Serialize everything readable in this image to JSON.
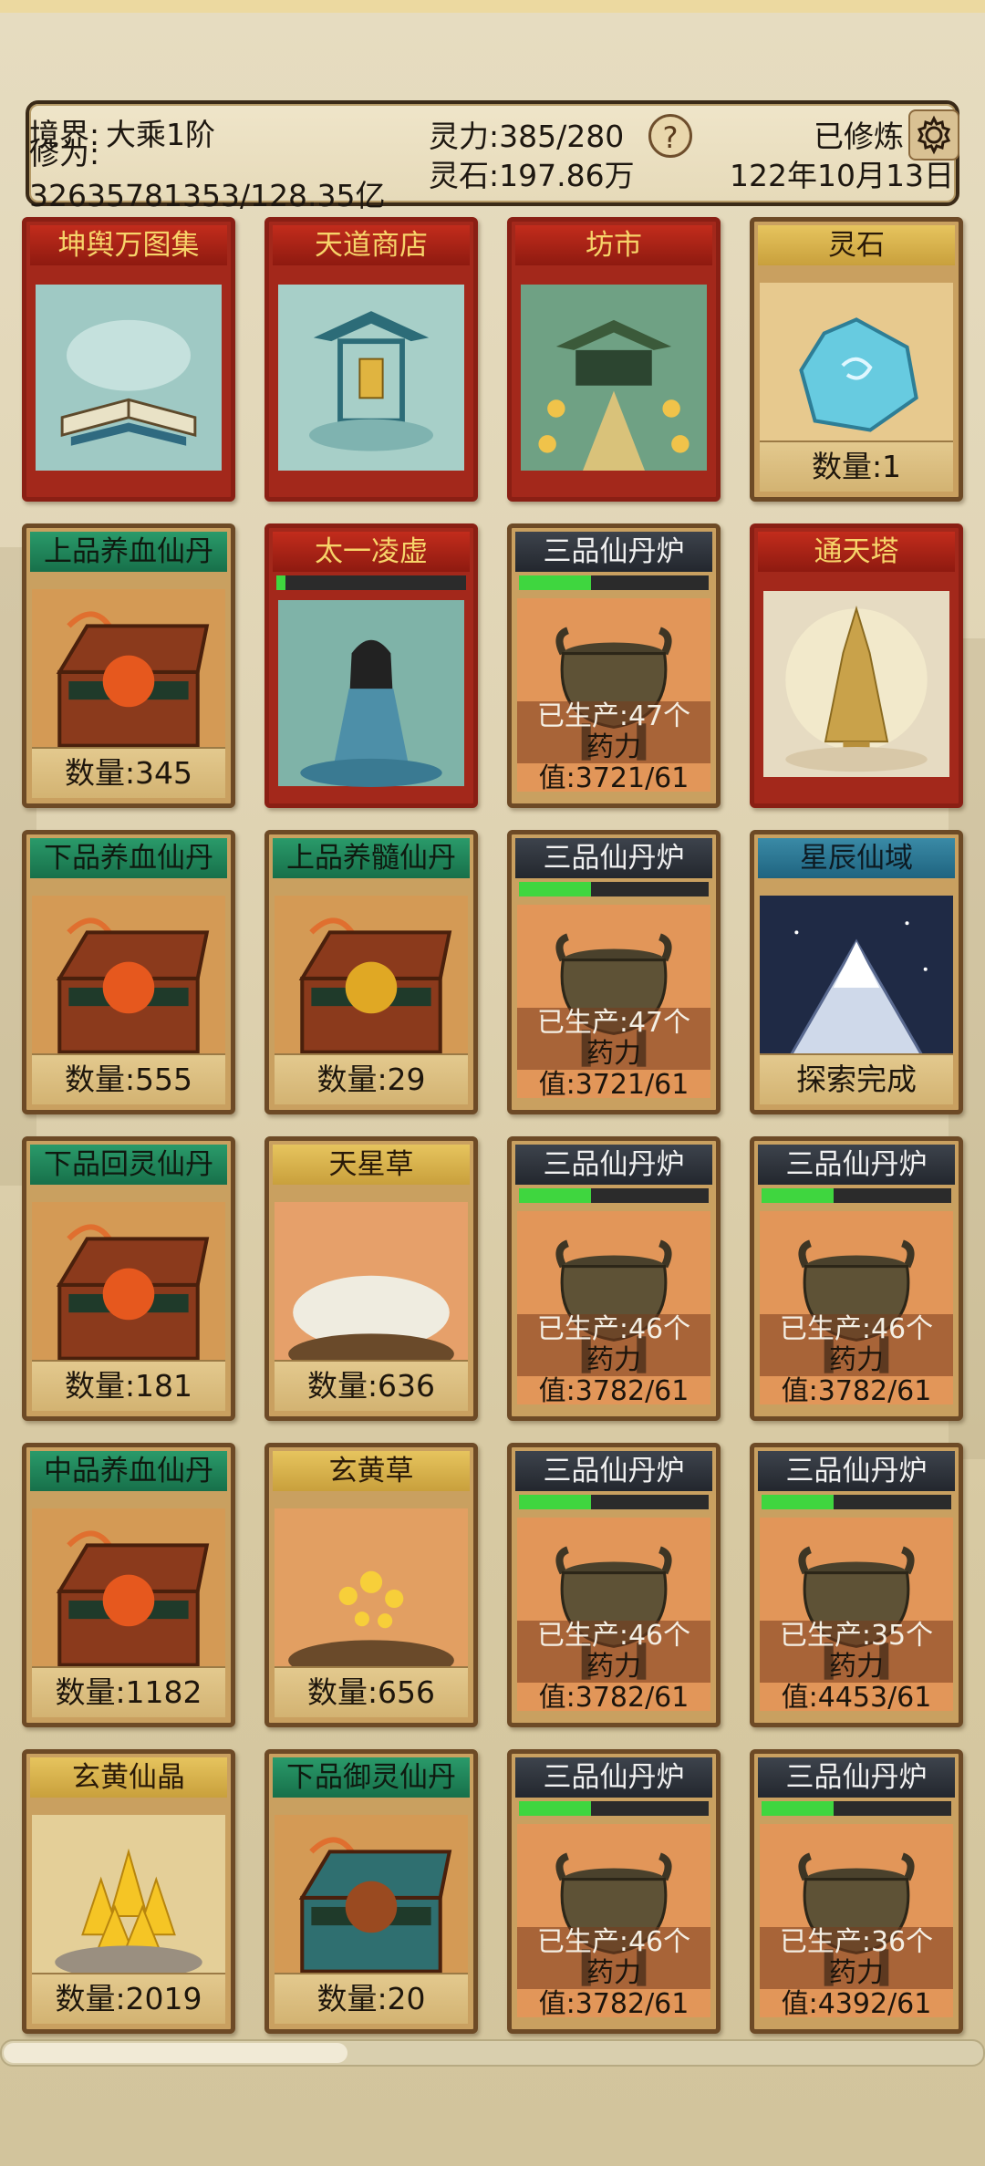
{
  "hud": {
    "realm_label": "境界:",
    "realm_value": "大乘1阶",
    "cultivation_label": "修为:",
    "cultivation_value": "32635781353/128.35亿",
    "spirit_power": "灵力:385/280",
    "spirit_stones": "灵石:197.86万",
    "help": "?",
    "status": "已修炼",
    "date": "122年10月13日"
  },
  "cards": [
    {
      "title": "坤舆万图集",
      "style": "red",
      "art": "book",
      "qty": ""
    },
    {
      "title": "天道商店",
      "style": "red",
      "art": "shrine",
      "qty": ""
    },
    {
      "title": "坊市",
      "style": "red",
      "art": "market",
      "qty": ""
    },
    {
      "title": "灵石",
      "style": "gold",
      "art": "gem",
      "qty": "数量:1"
    },
    {
      "title": "上品养血仙丹",
      "style": "green",
      "art": "chest-red",
      "qty": "数量:345"
    },
    {
      "title": "太一凌虚",
      "style": "red",
      "art": "cultivator",
      "qty": "",
      "progress": 0.05
    },
    {
      "title": "三品仙丹炉",
      "style": "dark",
      "art": "furnace",
      "progress": 0.38,
      "produced": "已生产:47个",
      "potency": "药力",
      "value": "值:3721/61"
    },
    {
      "title": "通天塔",
      "style": "red",
      "art": "tower",
      "qty": ""
    },
    {
      "title": "下品养血仙丹",
      "style": "green",
      "art": "chest-red",
      "qty": "数量:555"
    },
    {
      "title": "上品养髓仙丹",
      "style": "green",
      "art": "chest-gold",
      "qty": "数量:29"
    },
    {
      "title": "三品仙丹炉",
      "style": "dark",
      "art": "furnace",
      "progress": 0.38,
      "produced": "已生产:47个",
      "potency": "药力",
      "value": "值:3721/61"
    },
    {
      "title": "星辰仙域",
      "style": "blue",
      "art": "mountain",
      "qty": "探索完成"
    },
    {
      "title": "下品回灵仙丹",
      "style": "green",
      "art": "chest-red",
      "qty": "数量:181"
    },
    {
      "title": "天星草",
      "style": "gold",
      "art": "herb-white",
      "qty": "数量:636"
    },
    {
      "title": "三品仙丹炉",
      "style": "dark",
      "art": "furnace",
      "progress": 0.38,
      "produced": "已生产:46个",
      "potency": "药力",
      "value": "值:3782/61"
    },
    {
      "title": "三品仙丹炉",
      "style": "dark",
      "art": "furnace",
      "progress": 0.38,
      "produced": "已生产:46个",
      "potency": "药力",
      "value": "值:3782/61"
    },
    {
      "title": "中品养血仙丹",
      "style": "green",
      "art": "chest-red",
      "qty": "数量:1182"
    },
    {
      "title": "玄黄草",
      "style": "gold",
      "art": "herb-gold",
      "qty": "数量:656"
    },
    {
      "title": "三品仙丹炉",
      "style": "dark",
      "art": "furnace",
      "progress": 0.38,
      "produced": "已生产:46个",
      "potency": "药力",
      "value": "值:3782/61"
    },
    {
      "title": "三品仙丹炉",
      "style": "dark",
      "art": "furnace",
      "progress": 0.38,
      "produced": "已生产:35个",
      "potency": "药力",
      "value": "值:4453/61"
    },
    {
      "title": "玄黄仙晶",
      "style": "gold",
      "art": "crystal",
      "qty": "数量:2019"
    },
    {
      "title": "下品御灵仙丹",
      "style": "green",
      "art": "chest-teal",
      "qty": "数量:20"
    },
    {
      "title": "三品仙丹炉",
      "style": "dark",
      "art": "furnace",
      "progress": 0.38,
      "produced": "已生产:46个",
      "potency": "药力",
      "value": "值:3782/61"
    },
    {
      "title": "三品仙丹炉",
      "style": "dark",
      "art": "furnace",
      "progress": 0.38,
      "produced": "已生产:36个",
      "potency": "药力",
      "value": "值:4392/61"
    }
  ],
  "scroll": {
    "position": 0.35
  },
  "colors": {
    "accent_red": "#a3281b",
    "progress_green": "#3fd63f",
    "frame_brown": "#6d4a26"
  }
}
